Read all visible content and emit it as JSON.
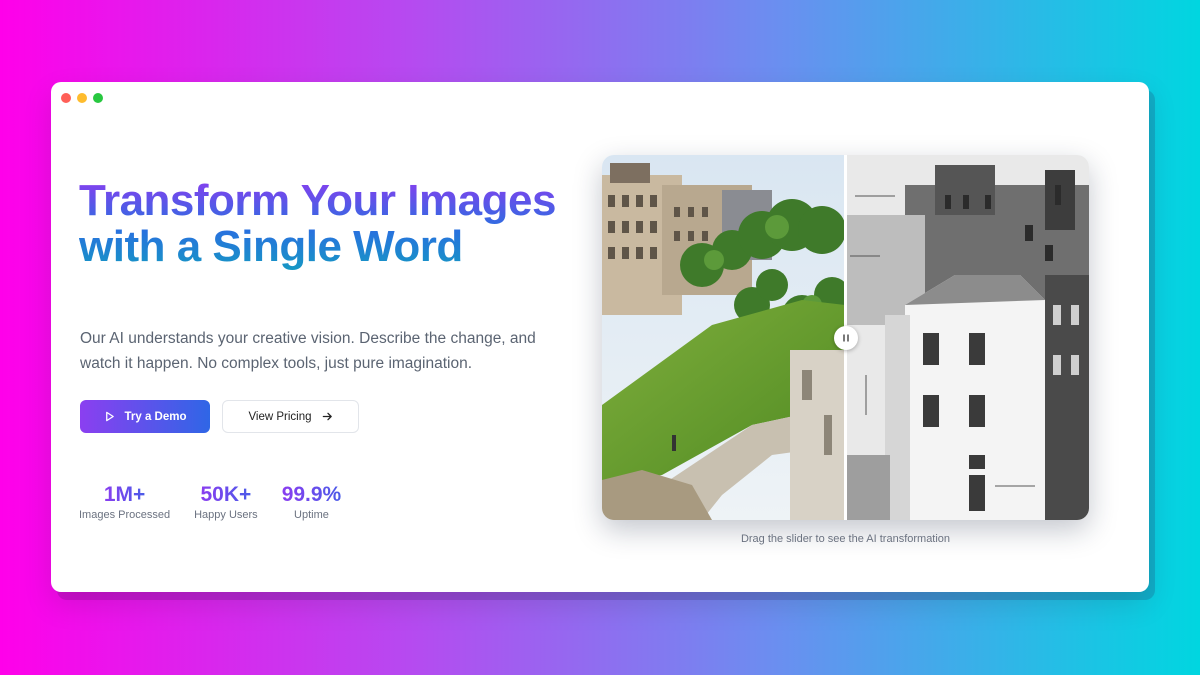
{
  "hero": {
    "title": "Transform Your Images with a Single Word",
    "description": "Our AI understands your creative vision. Describe the change, and watch it happen. No complex tools, just pure imagination."
  },
  "buttons": {
    "demo_label": "Try a Demo",
    "pricing_label": "View Pricing",
    "demo_icon": "play-icon",
    "pricing_icon": "arrow-right-icon"
  },
  "stats": [
    {
      "value": "1M+",
      "label": "Images Processed"
    },
    {
      "value": "50K+",
      "label": "Happy Users"
    },
    {
      "value": "99.9%",
      "label": "Uptime"
    }
  ],
  "comparison": {
    "caption": "Drag the slider to see the AI transformation",
    "slider_position": 0.5,
    "handle_icon": "pause-icon"
  },
  "colors": {
    "accent_purple": "#8a3df0",
    "accent_blue": "#2f66e6",
    "accent_teal": "#1697c4"
  }
}
